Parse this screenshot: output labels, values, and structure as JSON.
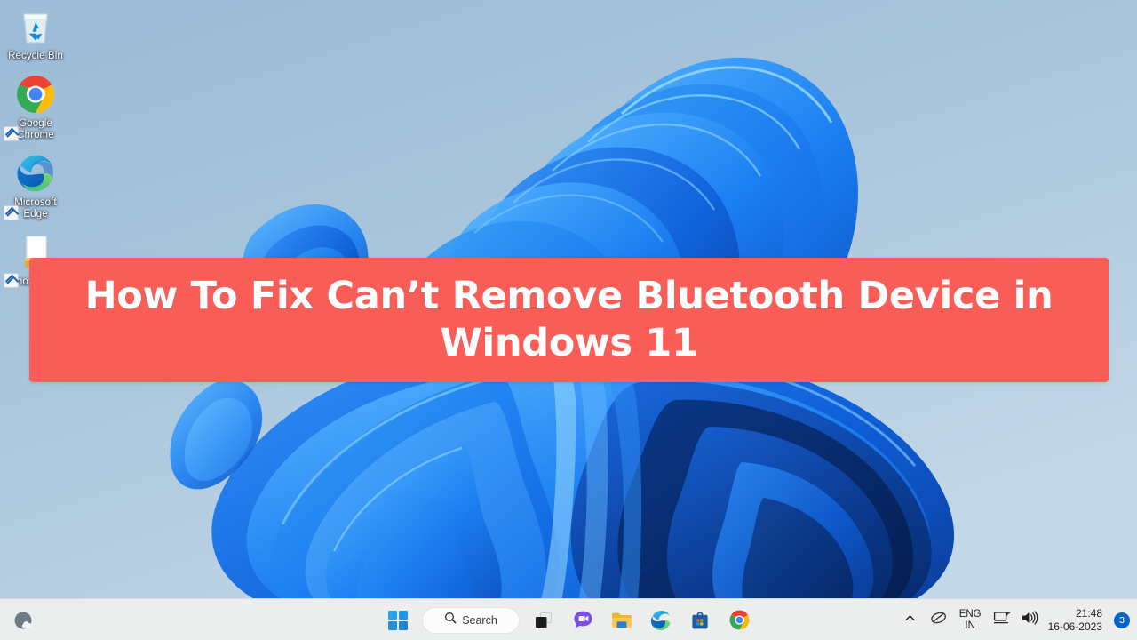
{
  "desktop": {
    "wallpaper_name": "windows-11-bloom-wallpaper",
    "background_color": "#a6c3da",
    "icons": [
      {
        "label": "Recycle Bin",
        "icon": "recycle-bin-icon",
        "shortcut": false
      },
      {
        "label": "Google Chrome",
        "icon": "google-chrome-icon",
        "shortcut": true
      },
      {
        "label": "Microsoft Edge",
        "icon": "microsoft-edge-icon",
        "shortcut": true
      },
      {
        "label": "notepad",
        "icon": "notepad-icon",
        "shortcut": true
      }
    ]
  },
  "banner": {
    "title": "How To Fix Can’t Remove Bluetooth Device in Windows 11",
    "background_color": "#f95d58",
    "text_color": "#ffffff"
  },
  "taskbar": {
    "background_color": "#eceded",
    "weather_widget": {
      "name": "weather-widget",
      "icon": "partly-cloudy-icon"
    },
    "start": {
      "label": "Start",
      "icon": "windows-logo-icon"
    },
    "search": {
      "label": "Search",
      "icon": "search-icon",
      "placeholder": "Search"
    },
    "pinned": [
      {
        "label": "Task View",
        "icon": "task-view-icon"
      },
      {
        "label": "Chat",
        "icon": "chat-icon"
      },
      {
        "label": "File Explorer",
        "icon": "file-explorer-icon"
      },
      {
        "label": "Microsoft Edge",
        "icon": "microsoft-edge-icon"
      },
      {
        "label": "Microsoft Store",
        "icon": "microsoft-store-icon"
      },
      {
        "label": "Google Chrome",
        "icon": "google-chrome-icon"
      }
    ],
    "tray": {
      "overflow": {
        "label": "Show hidden icons",
        "icon": "chevron-up-icon"
      },
      "pen": {
        "label": "Meet Now",
        "icon": "meet-now-icon"
      },
      "language": {
        "line1": "ENG",
        "line2": "IN"
      },
      "network": {
        "label": "Network",
        "icon": "network-icon"
      },
      "volume": {
        "label": "Volume",
        "icon": "speaker-icon"
      },
      "clock": {
        "time": "21:48",
        "date": "16-06-2023"
      },
      "notifications": {
        "count": "3",
        "accent_color": "#0a64c8"
      }
    }
  }
}
